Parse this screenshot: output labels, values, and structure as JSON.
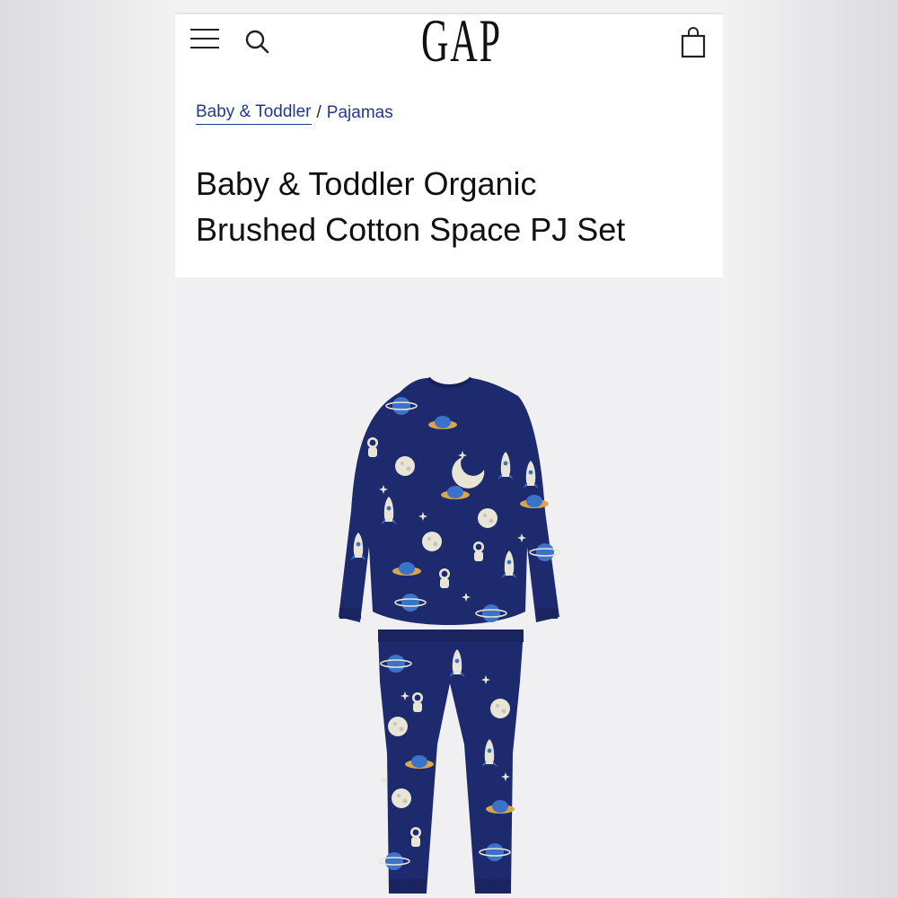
{
  "brand": {
    "logo_text": "GAP"
  },
  "header": {
    "icons": [
      "menu-icon",
      "search-icon",
      "shopping-bag-icon"
    ]
  },
  "breadcrumb": {
    "parent": "Baby & Toddler",
    "separator": "/",
    "current": "Pajamas"
  },
  "product": {
    "title_line1": "Baby & Toddler Organic",
    "title_line2": "Brushed Cotton Space PJ Set",
    "image_alt": "navy space print pajama set"
  },
  "colors": {
    "accent": "#1f3a8a",
    "garment": "#1e2a6e",
    "print_blue": "#3a73c9",
    "print_cream": "#e8e4d6"
  }
}
